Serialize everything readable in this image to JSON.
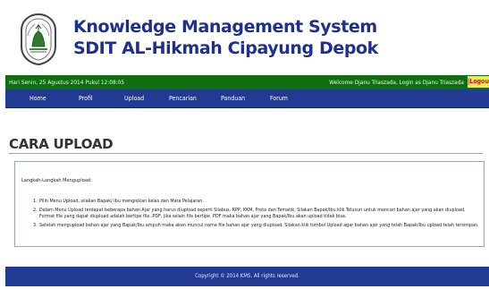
{
  "header": {
    "title_line1": "Knowledge Management System",
    "title_line2": "SDIT AL-Hikmah Cipayung Depok"
  },
  "status": {
    "datetime": "Hari Senin, 25 Agustus 2014 Pukul 12:08:05",
    "welcome": "Welcome Djanu Triaszada, Login as Djanu Triaszada",
    "logout_label": "|Logout"
  },
  "nav": {
    "items": [
      "Home",
      "Profil",
      "Upload",
      "Pencarian",
      "Panduan",
      "Forum"
    ]
  },
  "page": {
    "title": "CARA UPLOAD",
    "intro": "Langkah-Langkah Mengupload:",
    "steps": [
      "Pilih Menu Upload, silakan Bapak/ Ibu mengisikan kelas dan Mata Pelajaran.",
      "Dalam Menu Upload terdapat beberapa bahan Ajar yang harus diupload seperti Silabus, RPP, KKM, Prota dan Tematik. Silakan Bapak/Ibu klik Telusuri untuk mencari bahan ajar yang akan diupload. Format file yang dapat diupload adalah bertipe file .PDF, jika selain file bertipe .PDF maka bahan ajar yang Bapak/Ibu akan upload tidak bisa.",
      "Setelah mengupload bahan ajar yang Bapak/Ibu ampuh maka akan muncul nama file bahan ajar yang diupload. Silakan klik tombol Upload agar bahan ajar yang telah Bapak/Ibu upload telah tersimpan."
    ]
  },
  "footer": {
    "copyright": "Copyright © 2014 KMS. All rights reserved."
  },
  "colors": {
    "title": "#1d2f8f",
    "statusbar": "#0f6d12",
    "navbar": "#213a92",
    "logout_bg": "#f5e94a",
    "logout_text": "#c01818"
  },
  "icons": {
    "logo": "school-emblem-icon"
  }
}
